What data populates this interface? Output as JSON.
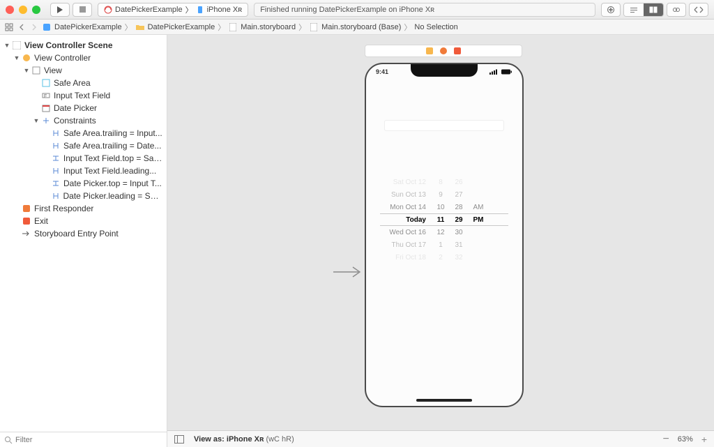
{
  "toolbar": {
    "scheme_app": "DatePickerExample",
    "scheme_device": "iPhone Xʀ",
    "status": "Finished running DatePickerExample on iPhone Xʀ"
  },
  "breadcrumb": {
    "items": [
      "DatePickerExample",
      "DatePickerExample",
      "Main.storyboard",
      "Main.storyboard (Base)",
      "No Selection"
    ]
  },
  "outline": {
    "scene": "View Controller Scene",
    "vc": "View Controller",
    "view": "View",
    "safe_area": "Safe Area",
    "text_field": "Input Text Field",
    "date_picker": "Date Picker",
    "constraints": "Constraints",
    "c_items": [
      "Safe Area.trailing = Input...",
      "Safe Area.trailing = Date...",
      "Input Text Field.top = Saf...",
      "Input Text Field.leading...",
      "Date Picker.top = Input T...",
      "Date Picker.leading = Saf..."
    ],
    "first_responder": "First Responder",
    "exit": "Exit",
    "entry": "Storyboard Entry Point"
  },
  "filter_placeholder": "Filter",
  "device": {
    "time": "9:41",
    "picker": {
      "rows": [
        {
          "day": "Sat Oct 12",
          "h": "8",
          "m": "26",
          "ap": ""
        },
        {
          "day": "Sun Oct 13",
          "h": "9",
          "m": "27",
          "ap": ""
        },
        {
          "day": "Mon Oct 14",
          "h": "10",
          "m": "28",
          "ap": "AM"
        },
        {
          "day": "Today",
          "h": "11",
          "m": "29",
          "ap": "PM"
        },
        {
          "day": "Wed Oct 16",
          "h": "12",
          "m": "30",
          "ap": ""
        },
        {
          "day": "Thu Oct 17",
          "h": "1",
          "m": "31",
          "ap": ""
        },
        {
          "day": "Fri Oct 18",
          "h": "2",
          "m": "32",
          "ap": ""
        }
      ]
    }
  },
  "bottom": {
    "view_as_label": "View as:",
    "view_as_value": "iPhone Xʀ",
    "traits": "(wC hR)",
    "zoom": "63%"
  }
}
